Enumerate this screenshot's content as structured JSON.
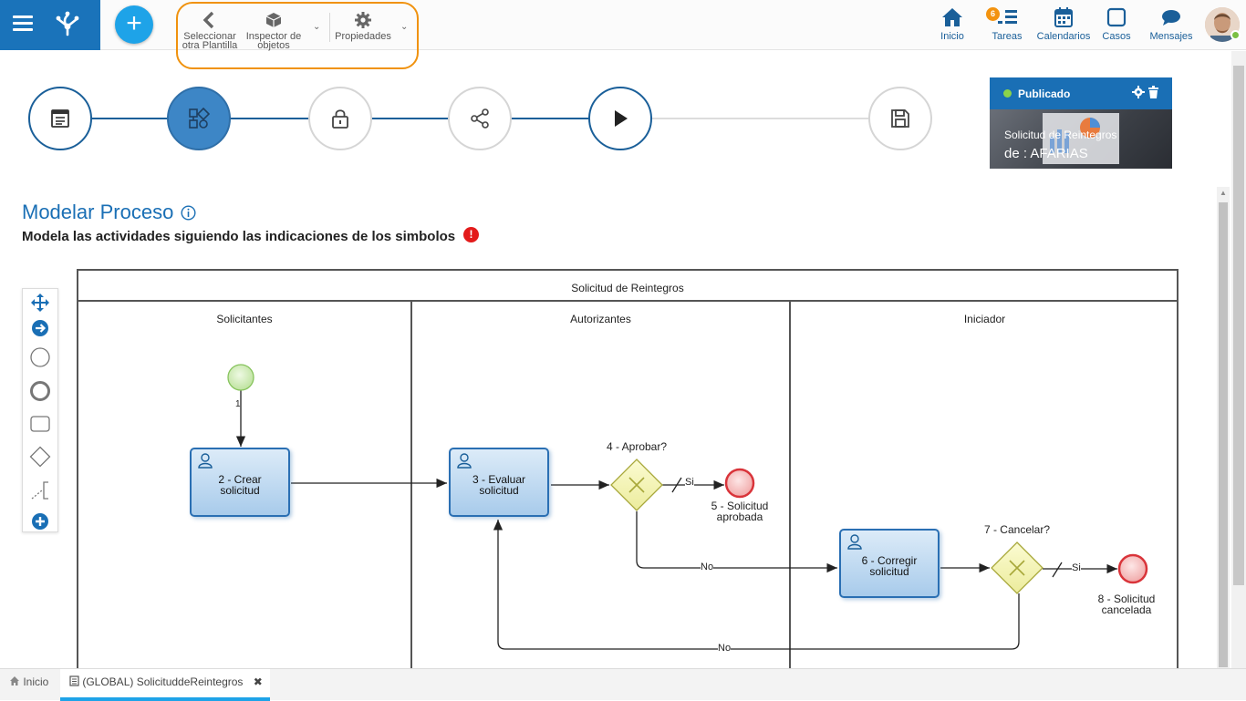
{
  "topbar": {
    "tools": [
      {
        "line1": "Seleccionar",
        "line2": "otra Plantilla",
        "icon": "chevron-left-icon"
      },
      {
        "line1": "Inspector de",
        "line2": "objetos",
        "icon": "cube-icon"
      },
      {
        "line1": "Propiedades",
        "line2": "",
        "icon": "gear-icon"
      }
    ],
    "nav": [
      {
        "label": "Inicio",
        "icon": "home-icon"
      },
      {
        "label": "Tareas",
        "icon": "tasks-icon",
        "badge": "6"
      },
      {
        "label": "Calendarios",
        "icon": "calendar-icon"
      },
      {
        "label": "Casos",
        "icon": "square-icon"
      },
      {
        "label": "Mensajes",
        "icon": "chat-icon"
      }
    ],
    "add_label": "+"
  },
  "status": {
    "label": "Publicado",
    "title": "Solicitud de Reintegros",
    "user": "de : AFARIAS"
  },
  "page": {
    "title": "Modelar Proceso",
    "subtitle": "Modela las actividades siguiendo las indicaciones de los simbolos",
    "warn": "!"
  },
  "diagram": {
    "pool": "Solicitud de  Reintegros",
    "lanes": [
      "Solicitantes",
      "Autorizantes",
      "Iniciador"
    ],
    "tasks": {
      "t2": "2 - Crear solicitud",
      "t3": "3 - Evaluar solicitud",
      "t6": "6 - Corregir solicitud"
    },
    "gateways": {
      "g4": "4 - Aprobar?",
      "g7": "7 - Cancelar?"
    },
    "ends": {
      "e5": "5 - Solicitud aprobada",
      "e8": "8 - Solicitud cancelada"
    },
    "start_label": "1",
    "flows": {
      "si1": "Si",
      "no1": "No",
      "si2": "Si",
      "no2": "No"
    }
  },
  "bottom": {
    "home": "Inicio",
    "tab": "(GLOBAL) SolicituddeReintegros",
    "close": "✖"
  },
  "colors": {
    "primary": "#1a6fb5",
    "accent": "#1ea3e8",
    "highlight": "#f0920e",
    "status_ok": "#8bd34a",
    "error": "#e31b1b"
  }
}
